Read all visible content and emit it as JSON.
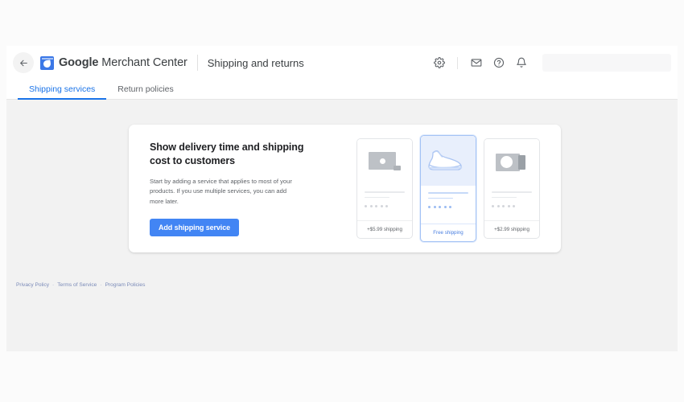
{
  "header": {
    "back_icon": "back-arrow-icon",
    "brand_bold": "Google",
    "brand_light": " Merchant Center",
    "logo_icon": "merchant-center-logo-icon",
    "page_title": "Shipping and returns",
    "icons": [
      {
        "name": "gear-icon",
        "glyph": "settings"
      },
      {
        "name": "mail-icon",
        "glyph": "envelope"
      },
      {
        "name": "help-icon",
        "glyph": "question"
      },
      {
        "name": "bell-icon",
        "glyph": "notification"
      }
    ],
    "search_placeholder": ""
  },
  "tabs": [
    {
      "label": "Shipping services",
      "active": true
    },
    {
      "label": "Return policies",
      "active": false
    }
  ],
  "hero": {
    "title": "Show delivery time and shipping cost to customers",
    "description": "Start by adding a service that applies to most of your products. If you use multiple services, you can add more later.",
    "cta_label": "Add shipping service"
  },
  "product_cards": [
    {
      "glyph": "laptop-placeholder-icon",
      "price_label": "+$5.99 shipping",
      "selected": false,
      "dots": 5
    },
    {
      "glyph": "sneaker-icon",
      "price_label": "Free shipping",
      "selected": true,
      "dots": 5
    },
    {
      "glyph": "camera-placeholder-icon",
      "price_label": "+$2.99 shipping",
      "selected": false,
      "dots": 5
    }
  ],
  "footer": {
    "links": [
      {
        "label": "Privacy Policy"
      },
      {
        "label": "Terms of Service"
      },
      {
        "label": "Program Policies"
      }
    ],
    "separator": "·"
  },
  "colors": {
    "accent_blue": "#1a73e8",
    "button_blue": "#4285f4",
    "selected_card_bg": "#e8effc",
    "page_bg": "#f2f2f2",
    "text_primary": "#202124",
    "text_secondary": "#5f6368"
  }
}
